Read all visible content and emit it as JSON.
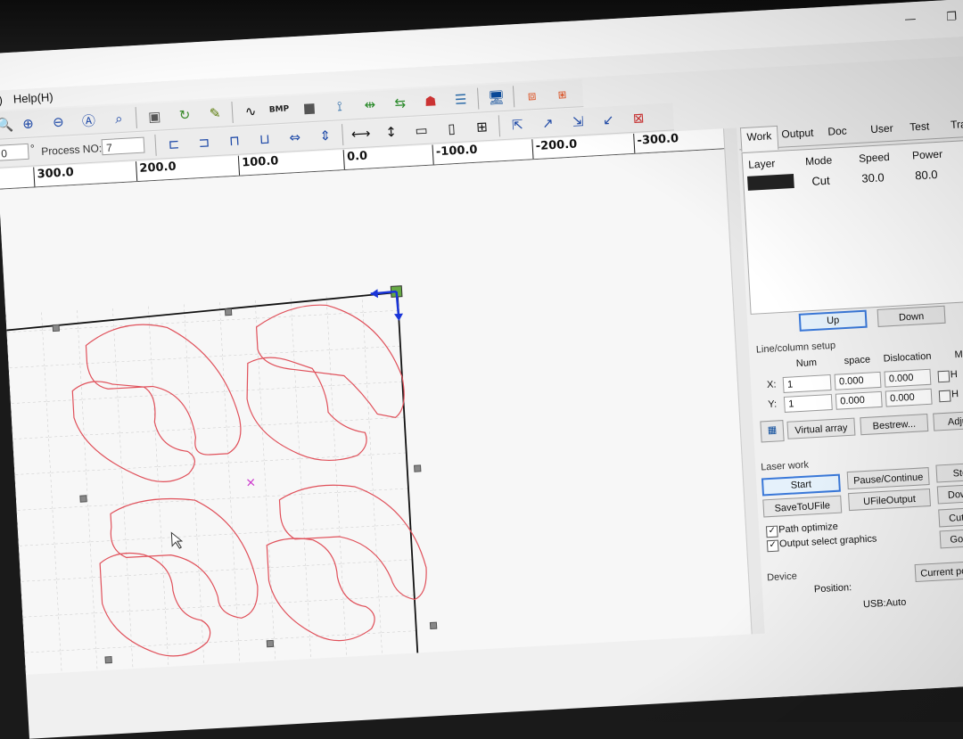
{
  "window": {
    "restore_glyph": "❐",
    "minimize_glyph": "—"
  },
  "menu": {
    "items": [
      "/)",
      "Help(H)"
    ]
  },
  "toolbar1": {
    "icons": [
      "zoom-icon",
      "zoom-in-icon",
      "zoom-out-icon",
      "zoom-fit-icon",
      "zoom-select-icon",
      "rectangle-icon",
      "rotate-icon",
      "pen-icon",
      "curve-icon",
      "bmp-icon",
      "square-icon",
      "node-icon",
      "array-h-icon",
      "array-v-icon",
      "laser-head-icon",
      "list-icon",
      "monitor-icon",
      "frame-icon",
      "frame-select-icon"
    ],
    "bmp_text": "BMP"
  },
  "toolbar2": {
    "angle_value": "0",
    "angle_unit": "°",
    "process_label": "Process NO:",
    "process_value": "7"
  },
  "ruler": {
    "labels": [
      "300.0",
      "200.0",
      "100.0",
      "0.0",
      "-100.0",
      "-200.0",
      "-300.0"
    ]
  },
  "panel": {
    "tabs": [
      "Work",
      "Output",
      "Doc",
      "User",
      "Test",
      "Tra"
    ],
    "layer_headers": [
      "Layer",
      "Mode",
      "Speed",
      "Power"
    ],
    "layer_row": {
      "mode": "Cut",
      "speed": "30.0",
      "power": "80.0",
      "color": "#222222"
    },
    "up_label": "Up",
    "down_label": "Down",
    "line_column_title": "Line/column setup",
    "lc_headers": [
      "Num",
      "space",
      "Dislocation",
      "Mirro"
    ],
    "x_label": "X:",
    "y_label": "Y:",
    "x_row": {
      "num": "1",
      "space": "0.000",
      "dislocation": "0.000",
      "mirror": "H"
    },
    "y_row": {
      "num": "1",
      "space": "0.000",
      "dislocation": "0.000",
      "mirror": "H"
    },
    "virtual_array_label": "Virtual array",
    "bestrew_label": "Bestrew...",
    "adjust_label": "Adjus",
    "laser_work_title": "Laser work",
    "start_label": "Start",
    "pause_label": "Pause/Continue",
    "stop_label": "Stop",
    "save_to_u_label": "SaveToUFile",
    "ufile_output_label": "UFileOutput",
    "download_label": "Downlo",
    "path_optimize_label": "Path optimize",
    "output_select_label": "Output select graphics",
    "cut_scale_label": "Cut sca",
    "go_scale_label": "Go scal",
    "device_title": "Device",
    "position_label": "Position:",
    "current_position_label": "Current position",
    "usb_label": "USB:Auto"
  },
  "colors": {
    "cut_path": "#e0505a",
    "frame": "#111111",
    "arrow": "#1a35d8",
    "center_mark": "#cc33cc"
  }
}
